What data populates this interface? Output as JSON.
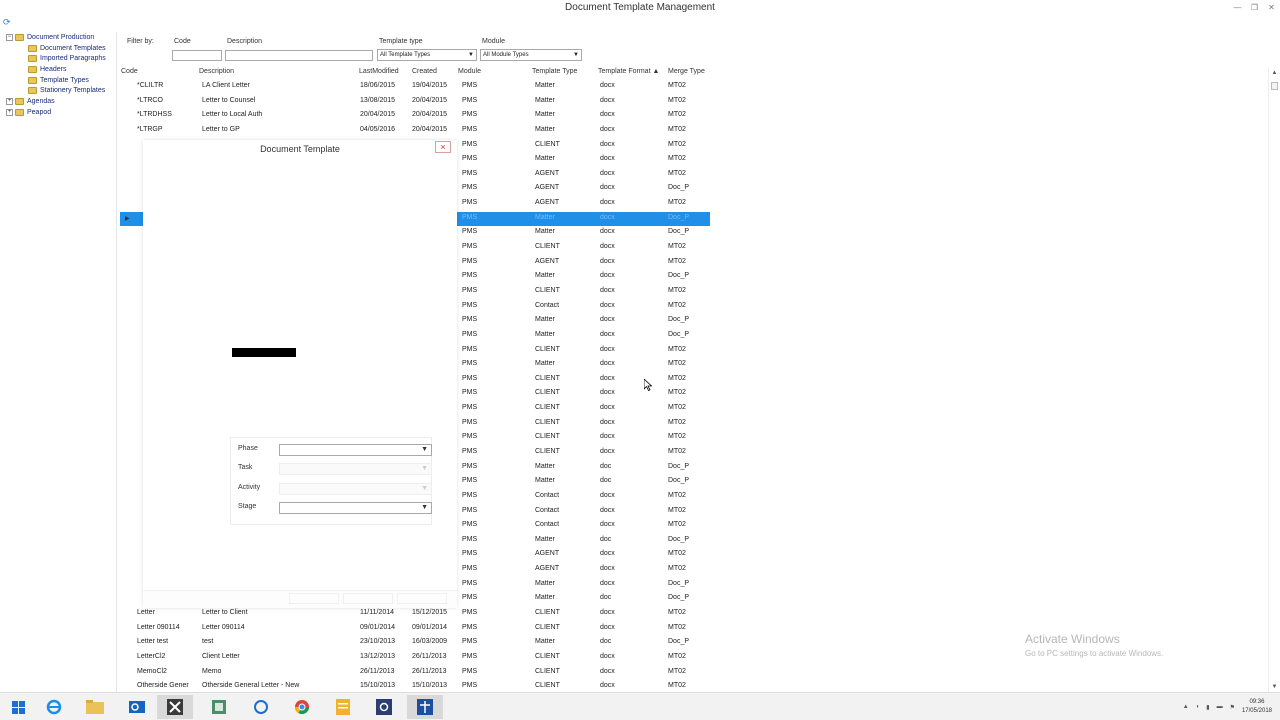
{
  "window": {
    "title": "Document Template Management"
  },
  "tree": {
    "root": "Document Production",
    "children": [
      "Document Templates",
      "Imported Paragraphs",
      "Headers",
      "Template Types",
      "Stationery Templates"
    ],
    "others": [
      "Agendas",
      "Peapod"
    ]
  },
  "filter": {
    "label": "Filter by:",
    "code_label": "Code",
    "description_label": "Description",
    "template_type_label": "Template type",
    "template_type_value": "All Template Types",
    "module_label": "Module",
    "module_value": "All Module Types"
  },
  "grid": {
    "headers": [
      "Code",
      "Description",
      "LastModified",
      "Created",
      "Module",
      "Template Type",
      "Template Format ▲",
      "Merge Type"
    ],
    "top_rows": [
      [
        "*CLILTR",
        "LA Client Letter",
        "18/06/2015",
        "19/04/2015",
        "PMS",
        "Matter",
        "docx",
        "MT02"
      ],
      [
        "*LTRCO",
        "Letter to Counsel",
        "13/08/2015",
        "20/04/2015",
        "PMS",
        "Matter",
        "docx",
        "MT02"
      ],
      [
        "*LTRDHSS",
        "Letter to Local Auth",
        "20/04/2015",
        "20/04/2015",
        "PMS",
        "Matter",
        "docx",
        "MT02"
      ],
      [
        "*LTRGP",
        "Letter to GP",
        "04/05/2016",
        "20/04/2015",
        "PMS",
        "Matter",
        "docx",
        "MT02"
      ]
    ],
    "partial_rows": [
      [
        "PMS",
        "CLIENT",
        "docx",
        "MT02"
      ],
      [
        "PMS",
        "Matter",
        "docx",
        "MT02"
      ],
      [
        "PMS",
        "AGENT",
        "docx",
        "MT02"
      ],
      [
        "PMS",
        "AGENT",
        "docx",
        "Doc_P"
      ],
      [
        "PMS",
        "AGENT",
        "docx",
        "MT02"
      ],
      [
        "PMS",
        "Matter",
        "docx",
        "Doc_P"
      ],
      [
        "PMS",
        "Matter",
        "docx",
        "Doc_P"
      ],
      [
        "PMS",
        "CLIENT",
        "docx",
        "MT02"
      ],
      [
        "PMS",
        "AGENT",
        "docx",
        "MT02"
      ],
      [
        "PMS",
        "Matter",
        "docx",
        "Doc_P"
      ],
      [
        "PMS",
        "CLIENT",
        "docx",
        "MT02"
      ],
      [
        "PMS",
        "Contact",
        "docx",
        "MT02"
      ],
      [
        "PMS",
        "Matter",
        "docx",
        "Doc_P"
      ],
      [
        "PMS",
        "Matter",
        "docx",
        "Doc_P"
      ],
      [
        "PMS",
        "CLIENT",
        "docx",
        "MT02"
      ],
      [
        "PMS",
        "Matter",
        "docx",
        "MT02"
      ],
      [
        "PMS",
        "CLIENT",
        "docx",
        "MT02"
      ],
      [
        "PMS",
        "CLIENT",
        "docx",
        "MT02"
      ],
      [
        "PMS",
        "CLIENT",
        "docx",
        "MT02"
      ],
      [
        "PMS",
        "CLIENT",
        "docx",
        "MT02"
      ],
      [
        "PMS",
        "CLIENT",
        "docx",
        "MT02"
      ],
      [
        "PMS",
        "CLIENT",
        "docx",
        "MT02"
      ],
      [
        "PMS",
        "Matter",
        "doc",
        "Doc_P"
      ],
      [
        "PMS",
        "Matter",
        "doc",
        "Doc_P"
      ],
      [
        "PMS",
        "Contact",
        "docx",
        "MT02"
      ],
      [
        "PMS",
        "Contact",
        "docx",
        "MT02"
      ],
      [
        "PMS",
        "Contact",
        "docx",
        "MT02"
      ],
      [
        "PMS",
        "Matter",
        "doc",
        "Doc_P"
      ],
      [
        "PMS",
        "AGENT",
        "docx",
        "MT02"
      ],
      [
        "PMS",
        "AGENT",
        "docx",
        "MT02"
      ],
      [
        "PMS",
        "Matter",
        "docx",
        "Doc_P"
      ],
      [
        "PMS",
        "Matter",
        "doc",
        "Doc_P"
      ]
    ],
    "bottom_rows": [
      [
        "Letter",
        "Letter to Client",
        "11/11/2014",
        "15/12/2015",
        "PMS",
        "CLIENT",
        "docx",
        "MT02"
      ],
      [
        "Letter 090114",
        "Letter 090114",
        "09/01/2014",
        "09/01/2014",
        "PMS",
        "CLIENT",
        "docx",
        "MT02"
      ],
      [
        "Letter test",
        "test",
        "23/10/2013",
        "16/03/2009",
        "PMS",
        "Matter",
        "doc",
        "Doc_P"
      ],
      [
        "LetterCl2",
        "Client Letter",
        "13/12/2013",
        "26/11/2013",
        "PMS",
        "CLIENT",
        "docx",
        "MT02"
      ],
      [
        "MemoCl2",
        "Memo",
        "26/11/2013",
        "26/11/2013",
        "PMS",
        "CLIENT",
        "docx",
        "MT02"
      ],
      [
        "Otherside Gener",
        "Otherside General Letter - New",
        "15/10/2013",
        "15/10/2013",
        "PMS",
        "CLIENT",
        "docx",
        "MT02"
      ]
    ]
  },
  "dialog": {
    "title": "Document Template",
    "close": "×",
    "fields": [
      "Phase",
      "Task",
      "Activity",
      "Stage"
    ]
  },
  "watermark": {
    "line1": "Activate Windows",
    "line2": "Go to PC settings to activate Windows."
  },
  "taskbar": {
    "time": "09:36",
    "date": "17/05/2018"
  }
}
